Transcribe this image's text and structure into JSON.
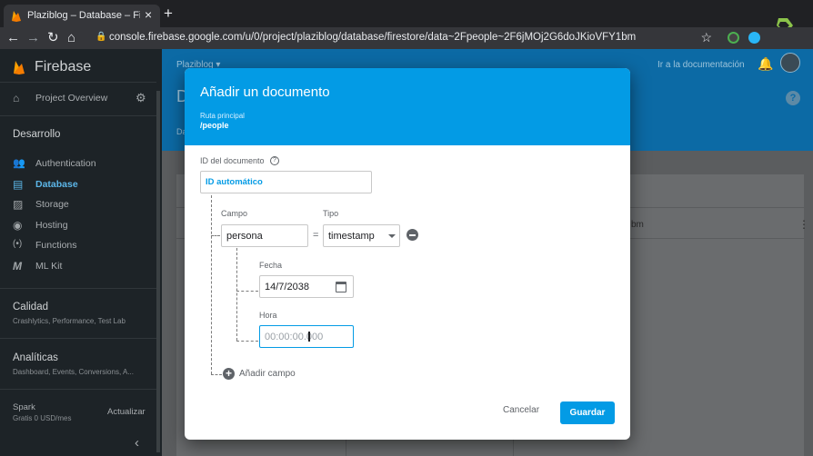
{
  "browser": {
    "tab_title": "Plaziblog – Database – Firebase",
    "new_tab": "+",
    "tab_close": "×",
    "url": "console.firebase.google.com/u/0/project/plaziblog/database/firestore/data~2Fpeople~2F6jMOj2G6doJKioVFY1bm"
  },
  "sidebar": {
    "brand": "Firebase",
    "overview": "Project Overview",
    "section_dev": "Desarrollo",
    "items": [
      {
        "label": "Authentication",
        "icon": "people-icon"
      },
      {
        "label": "Database",
        "icon": "database-icon"
      },
      {
        "label": "Storage",
        "icon": "storage-icon"
      },
      {
        "label": "Hosting",
        "icon": "hosting-icon"
      },
      {
        "label": "Functions",
        "icon": "functions-icon"
      },
      {
        "label": "ML Kit",
        "icon": "mlkit-icon"
      }
    ],
    "quality_title": "Calidad",
    "quality_sub": "Crashlytics, Performance, Test Lab",
    "analytics_title": "Analíticas",
    "analytics_sub": "Dashboard, Events, Conversions, A...",
    "plan_title": "Spark",
    "plan_sub": "Gratis 0 USD/mes",
    "upgrade": "Actualizar",
    "collapse": "‹"
  },
  "header": {
    "project": "Plaziblog ▾",
    "docs_link": "Ir a la documentación",
    "page_letter": "D",
    "tab": "Da",
    "help": "?"
  },
  "panel": {
    "row_text": "bm",
    "kebab": "⋮"
  },
  "dialog": {
    "title": "Añadir un documento",
    "path_label": "Ruta principal",
    "path": "/people",
    "doc_id_label": "ID del documento",
    "help": "?",
    "auto_id": "ID automático",
    "field_label": "Campo",
    "type_label": "Tipo",
    "field_value": "persona",
    "equals": "=",
    "type_value": "timestamp",
    "date_label": "Fecha",
    "date_value": "14/7/2038",
    "time_label": "Hora",
    "time_placeholder": "00:00:00.000",
    "add_icon": "+",
    "add_field": "Añadir campo",
    "cancel": "Cancelar",
    "save": "Guardar"
  },
  "colors": {
    "accent": "#039be5",
    "sidebar_bg": "#1d2327",
    "header_bg": "#0c6aa5"
  }
}
